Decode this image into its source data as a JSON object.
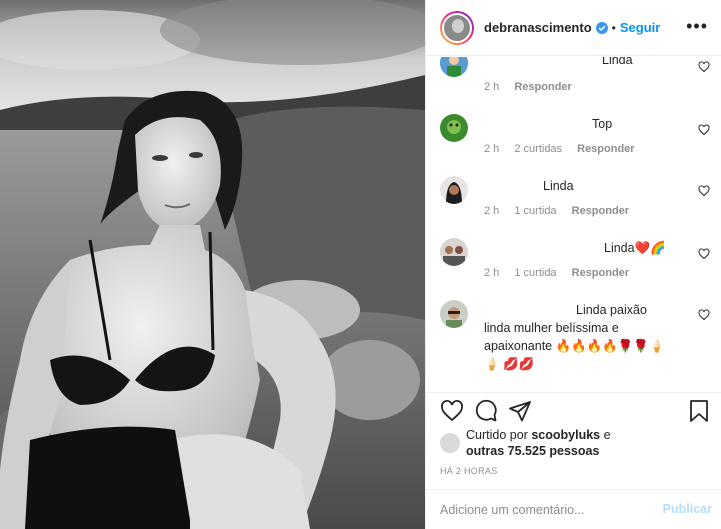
{
  "header": {
    "username": "debranascimento",
    "separator": "•",
    "follow_label": "Seguir",
    "more_label": "•••"
  },
  "comments": [
    {
      "text": "Linda",
      "time": "2 h",
      "likes": "",
      "reply": "Responder"
    },
    {
      "text": "Top",
      "time": "2 h",
      "likes": "2 curtidas",
      "reply": "Responder"
    },
    {
      "text": "Linda",
      "time": "2 h",
      "likes": "1 curtida",
      "reply": "Responder"
    },
    {
      "text": "Linda❤️🌈",
      "time": "2 h",
      "likes": "1 curtida",
      "reply": "Responder"
    },
    {
      "text": "Linda paixão linda mulher belíssima e apaixonante 🔥🔥🔥🔥🌹🌹🍦🍦 💋💋",
      "time": "",
      "likes": "",
      "reply": ""
    }
  ],
  "likes": {
    "prefix": "Curtido por",
    "user": "scoobyluks",
    "middle": "e",
    "others": "outras 75.525 pessoas"
  },
  "time_ago": "HÁ 2 HORAS",
  "add_comment": {
    "placeholder": "Adicione um comentário...",
    "post_label": "Publicar"
  },
  "colors": {
    "link_blue": "#0095f6",
    "muted_gray": "#8e8e8e",
    "post_disabled": "#b2dffc",
    "border": "#efefef"
  },
  "icons": [
    "heart-icon",
    "comment-icon",
    "share-icon",
    "bookmark-icon",
    "verified-icon",
    "more-icon"
  ]
}
